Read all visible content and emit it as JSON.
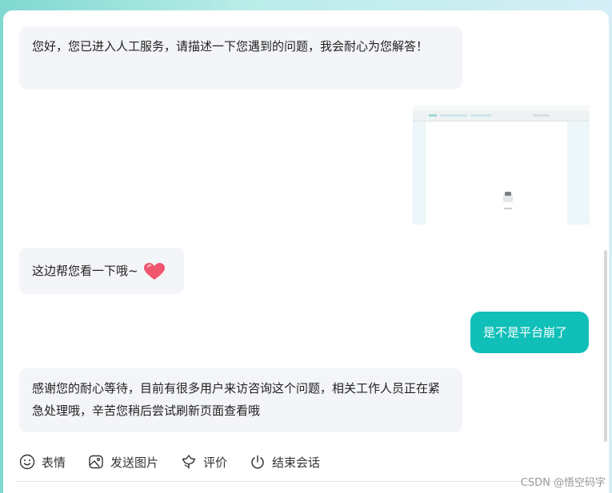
{
  "messages": {
    "m1": "您好，您已进入人工服务，请描述一下您遇到的问题，我会耐心为您解答！",
    "m2": "这边帮您看一下哦~",
    "m3": "是不是平台崩了",
    "m4": "感谢您的耐心等待，目前有很多用户来访咨询这个问题，相关工作人员正在紧急处理哦，辛苦您稍后尝试刷新页面查看哦"
  },
  "toolbar": {
    "emoji": "表情",
    "send_image": "发送图片",
    "rate": "评价",
    "end_chat": "结束会话"
  },
  "icons": {
    "emoji": "smile-icon",
    "send_image": "image-icon",
    "rate": "flower-icon",
    "end_chat": "power-icon",
    "heart": "heart-icon"
  },
  "colors": {
    "user_bubble": "#10bfb8",
    "agent_bubble": "#f3f5f8",
    "heart": "#f0566c"
  },
  "watermark": "CSDN @悟空码字"
}
